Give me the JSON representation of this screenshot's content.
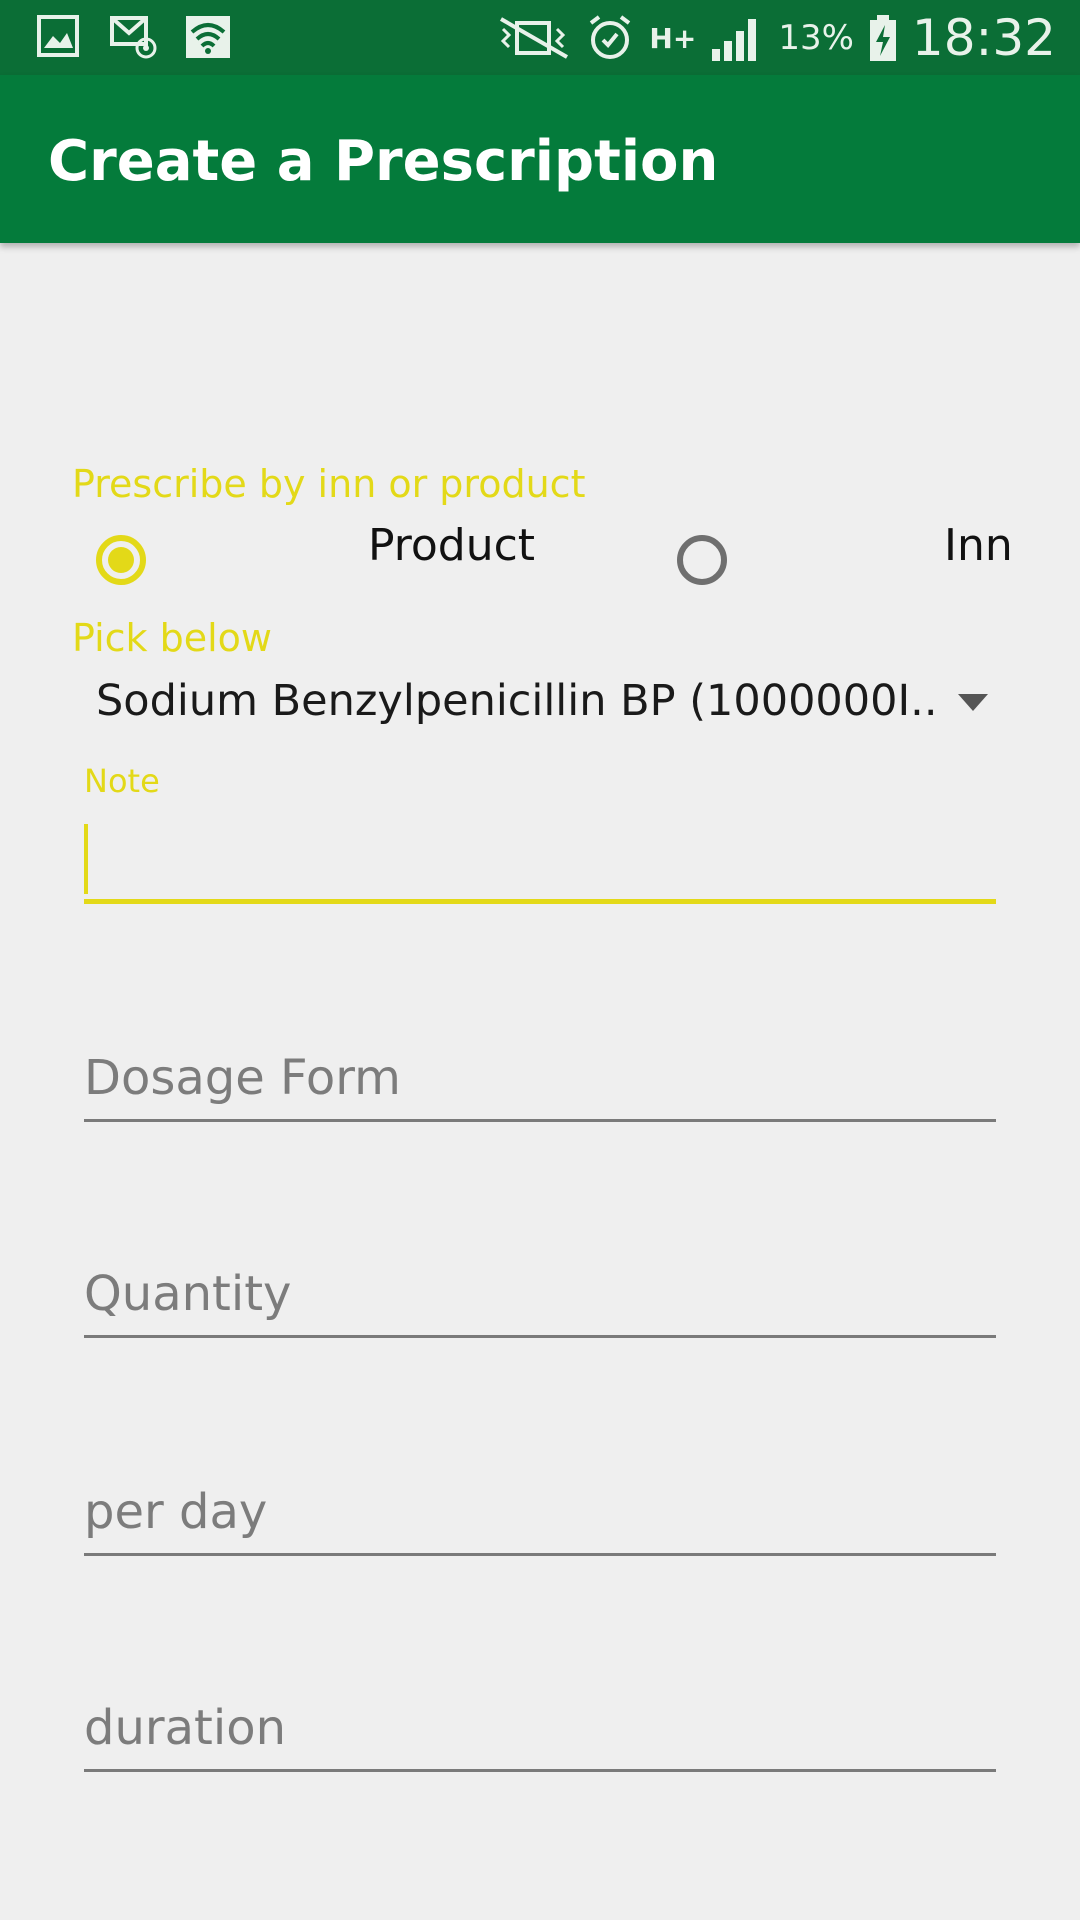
{
  "status_bar": {
    "battery": "13%",
    "time": "18:32",
    "network": "H+",
    "icons": [
      "gallery-icon",
      "email-icon",
      "wifi-icon",
      "mute-icon",
      "alarm-icon",
      "network-type-icon",
      "signal-icon",
      "battery-charging-icon"
    ]
  },
  "app_bar": {
    "title": "Create a Prescription"
  },
  "form": {
    "prescribe_label": "Prescribe by inn or product",
    "radio_product_label": "Product",
    "radio_inn_label": "Inn",
    "selected_option": "Product",
    "pick_label": "Pick below",
    "spinner_value": "Sodium  Benzylpenicillin BP (1000000I..",
    "note_label": "Note",
    "note_value": "",
    "dosage_placeholder": "Dosage Form",
    "quantity_placeholder": "Quantity",
    "perday_placeholder": "per day",
    "duration_placeholder": "duration"
  },
  "colors": {
    "status_bar": "#0b6e36",
    "app_bar": "#047b3b",
    "accent": "#e3d918",
    "background": "#efefef"
  }
}
